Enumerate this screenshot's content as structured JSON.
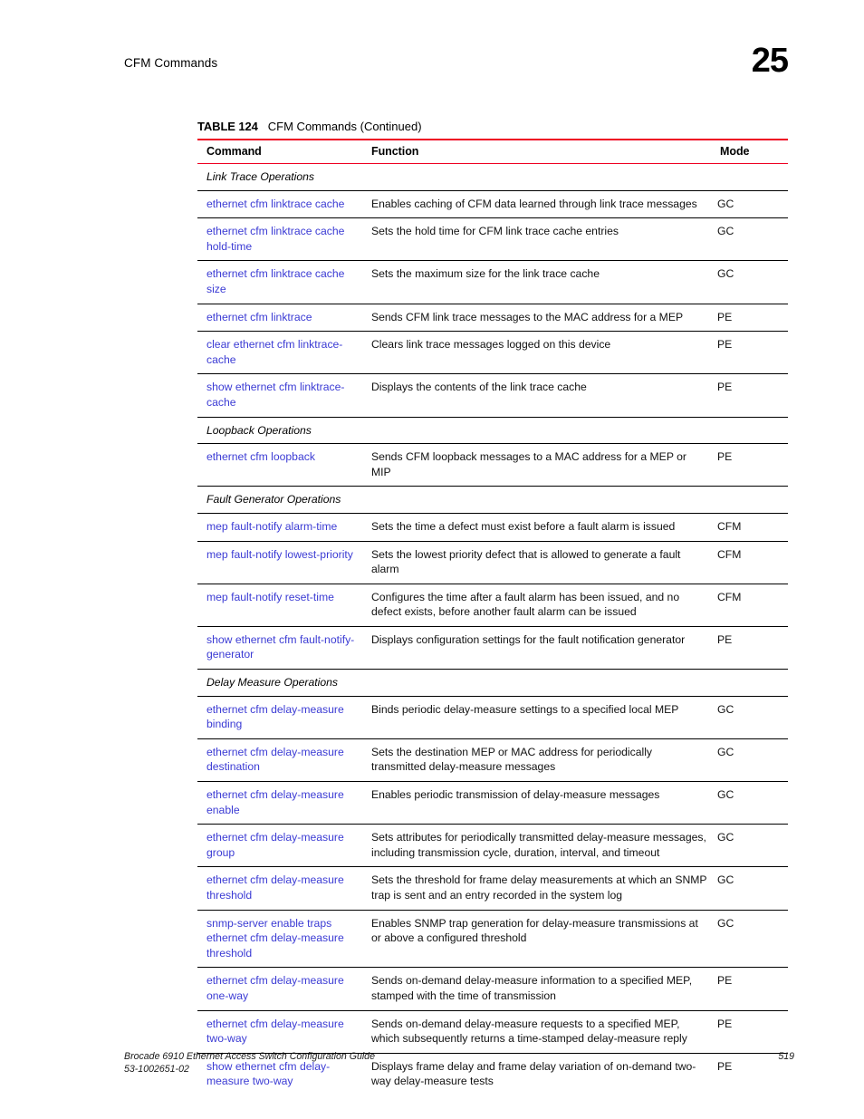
{
  "header": {
    "running_head": "CFM Commands",
    "chapter_number": "25"
  },
  "table": {
    "caption_label": "TABLE 124",
    "caption_text": "CFM Commands (Continued)",
    "columns": {
      "command": "Command",
      "function": "Function",
      "mode": "Mode"
    },
    "rows": [
      {
        "type": "section",
        "label": "Link Trace Operations"
      },
      {
        "type": "entry",
        "command": "ethernet cfm linktrace cache",
        "function": "Enables caching of CFM data learned through link trace messages",
        "mode": "GC"
      },
      {
        "type": "entry",
        "command": "ethernet cfm linktrace cache hold-time",
        "function": "Sets the hold time for CFM link trace cache entries",
        "mode": "GC"
      },
      {
        "type": "entry",
        "command": "ethernet cfm linktrace cache size",
        "function": "Sets the maximum size for the link trace cache",
        "mode": "GC"
      },
      {
        "type": "entry",
        "command": "ethernet cfm linktrace",
        "function": "Sends CFM link trace messages to the MAC address for a MEP",
        "mode": "PE"
      },
      {
        "type": "entry",
        "command": "clear ethernet cfm linktrace-cache",
        "function": "Clears link trace messages logged on this device",
        "mode": "PE"
      },
      {
        "type": "entry",
        "command": "show ethernet cfm linktrace-cache",
        "function": "Displays the contents of the link trace cache",
        "mode": "PE"
      },
      {
        "type": "section",
        "label": "Loopback Operations"
      },
      {
        "type": "entry",
        "command": "ethernet cfm loopback",
        "function": "Sends CFM loopback messages to a MAC address for a MEP or MIP",
        "mode": "PE"
      },
      {
        "type": "section",
        "label": "Fault Generator Operations"
      },
      {
        "type": "entry",
        "command": "mep fault-notify alarm-time",
        "function": "Sets the time a defect must exist before a fault alarm is issued",
        "mode": "CFM"
      },
      {
        "type": "entry",
        "command": "mep fault-notify lowest-priority",
        "function": "Sets the lowest priority defect that is allowed to generate a fault alarm",
        "mode": "CFM"
      },
      {
        "type": "entry",
        "command": "mep fault-notify reset-time",
        "function": "Configures the time after a fault alarm has been issued, and no defect exists, before another fault alarm can be issued",
        "mode": "CFM"
      },
      {
        "type": "entry",
        "command": "show ethernet cfm fault-notify-generator",
        "function": "Displays configuration settings for the fault notification generator",
        "mode": "PE"
      },
      {
        "type": "section",
        "label": "Delay Measure Operations"
      },
      {
        "type": "entry",
        "command": "ethernet cfm delay-measure binding",
        "function": "Binds periodic delay-measure settings to a specified local MEP",
        "mode": "GC"
      },
      {
        "type": "entry",
        "command": "ethernet cfm delay-measure destination",
        "function": "Sets the destination MEP or MAC address for periodically transmitted delay-measure messages",
        "mode": "GC"
      },
      {
        "type": "entry",
        "command": "ethernet cfm delay-measure enable",
        "function": "Enables periodic transmission of delay-measure messages",
        "mode": "GC"
      },
      {
        "type": "entry",
        "command": "ethernet cfm delay-measure group",
        "function": "Sets attributes for periodically transmitted delay-measure messages, including transmission cycle, duration, interval, and timeout",
        "mode": "GC"
      },
      {
        "type": "entry",
        "command": "ethernet cfm delay-measure threshold",
        "function": "Sets the threshold for frame delay measurements at which an SNMP trap is sent and an entry recorded in the system log",
        "mode": "GC"
      },
      {
        "type": "entry",
        "command": "snmp-server enable traps ethernet cfm delay-measure threshold",
        "function": "Enables SNMP trap generation for delay-measure transmissions at or above a configured threshold",
        "mode": "GC"
      },
      {
        "type": "entry",
        "command": "ethernet cfm delay-measure one-way",
        "function": "Sends on-demand delay-measure information to a specified MEP, stamped with the time of transmission",
        "mode": "PE"
      },
      {
        "type": "entry",
        "command": "ethernet cfm delay-measure two-way",
        "function": "Sends on-demand delay-measure requests to a specified MEP, which subsequently returns a time-stamped delay-measure reply",
        "mode": "PE"
      },
      {
        "type": "entry",
        "command": "show ethernet cfm delay-measure two-way",
        "function": "Displays frame delay and frame delay variation of on-demand two-way delay-measure tests",
        "mode": "PE"
      }
    ]
  },
  "footer": {
    "doc_title": "Brocade 6910 Ethernet Access Switch Configuration Guide",
    "doc_part": "53-1002651-02",
    "page_number": "519"
  },
  "colors": {
    "rule_red": "#ee0022",
    "command_link": "#3b3bd4"
  }
}
